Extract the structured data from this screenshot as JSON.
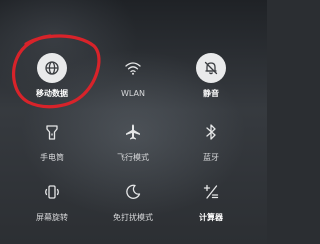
{
  "tiles": [
    {
      "label": "移动数据",
      "icon": "globe-icon",
      "state": "on"
    },
    {
      "label": "WLAN",
      "icon": "wifi-icon",
      "state": "off"
    },
    {
      "label": "静音",
      "icon": "bell-off-icon",
      "state": "on"
    },
    {
      "label": "手电筒",
      "icon": "flashlight-icon",
      "state": "off"
    },
    {
      "label": "飞行模式",
      "icon": "airplane-icon",
      "state": "off"
    },
    {
      "label": "蓝牙",
      "icon": "bluetooth-icon",
      "state": "off"
    },
    {
      "label": "屏幕旋转",
      "icon": "rotate-icon",
      "state": "off"
    },
    {
      "label": "免打扰模式",
      "icon": "moon-icon",
      "state": "off"
    },
    {
      "label": "计算器",
      "icon": "calculator-icon",
      "state": "on"
    }
  ],
  "colors": {
    "tile_on_bg": "#e9eaeb",
    "icon_on": "#3a3d41",
    "icon_off": "#e6e7e8",
    "annotation_red": "#d8232a"
  }
}
